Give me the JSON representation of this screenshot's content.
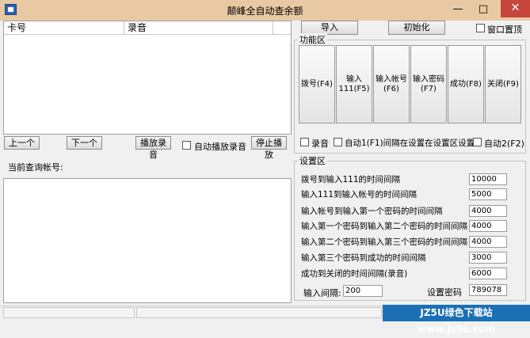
{
  "window": {
    "title": "颠峰全自动查余额"
  },
  "titlebar": {
    "minimize": "—",
    "maximize": "□",
    "close": "✕"
  },
  "table": {
    "columns": [
      "卡号",
      "录音"
    ]
  },
  "nav": {
    "prev": "上一个",
    "next": "下一个",
    "play": "播放录音",
    "auto_play": "自动播放录音",
    "stop": "停止播放"
  },
  "current_account_label": "当前查询帐号:",
  "top": {
    "import": "导入",
    "init": "初始化",
    "topmost": "窗口置顶"
  },
  "function_area": {
    "legend": "功能区",
    "buttons": [
      "拨号(F4)",
      "输入\n111(F5)",
      "输入帐号\n(F6)",
      "输入密码\n(F7)",
      "成功(F8)",
      "关闭(F9)"
    ],
    "record": "录音",
    "auto1": "自动1(F1)间隔在设置在设置区设置",
    "auto2": "自动2(F2)"
  },
  "settings": {
    "legend": "设置区",
    "rows": [
      {
        "label": "拨号到输入111的时间间隔",
        "value": "10000"
      },
      {
        "label": "输入111到输入帐号的时间间隔",
        "value": "5000"
      },
      {
        "label": "输入帐号到输入第一个密码的时间间隔",
        "value": "4000"
      },
      {
        "label": "输入第一个密码到输入第二个密码的时间间隔",
        "value": "4000"
      },
      {
        "label": "输入第二个密码到输入第三个密码的时间间隔",
        "value": "4000"
      },
      {
        "label": "输入第三个密码到成功的时间间隔",
        "value": "3000"
      },
      {
        "label": "成功到关闭的时间间隔(录音)",
        "value": "6000"
      }
    ],
    "input_interval_label": "输入间隔:",
    "input_interval_value": "200",
    "password_label": "设置密码",
    "password_value": "789078"
  },
  "watermark": "JZ5U绿色下载站www.jz5u.com"
}
